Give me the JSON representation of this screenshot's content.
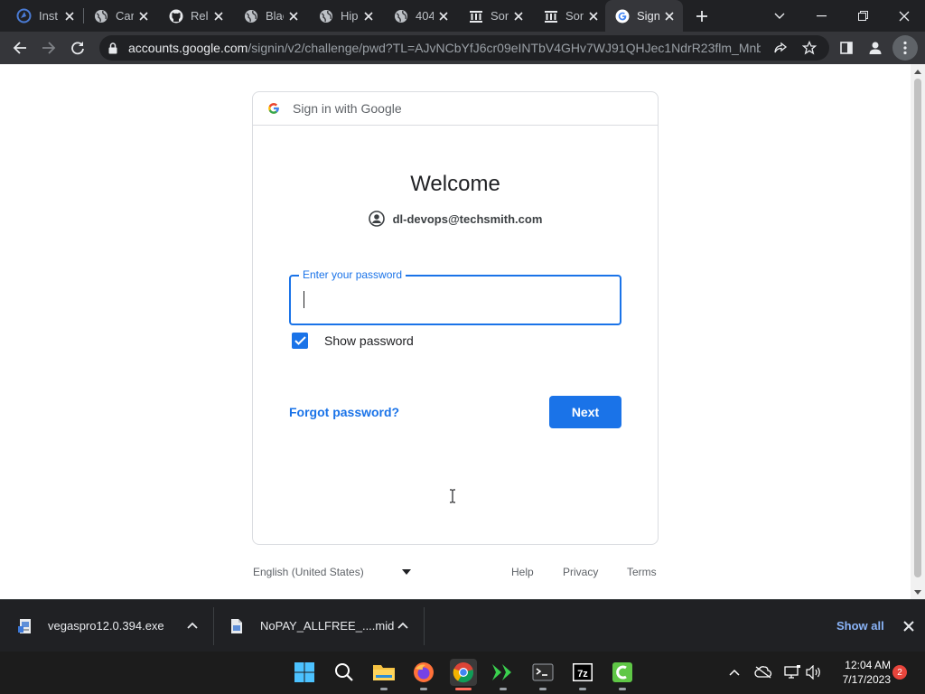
{
  "browser": {
    "tabs": [
      {
        "label": "Inst",
        "icon": "scirate-icon"
      },
      {
        "label": "Car",
        "icon": "globe-icon"
      },
      {
        "label": "Rele",
        "icon": "github-icon"
      },
      {
        "label": "Blac",
        "icon": "globe-icon"
      },
      {
        "label": "Hip",
        "icon": "globe-icon"
      },
      {
        "label": "404",
        "icon": "globe-icon"
      },
      {
        "label": "Son",
        "icon": "institution-icon"
      },
      {
        "label": "Son",
        "icon": "institution-icon"
      },
      {
        "label": "Sign",
        "icon": "google-icon",
        "active": true
      }
    ],
    "url_host": "accounts.google.com",
    "url_path": "/signin/v2/challenge/pwd?TL=AJvNCbYfJ6cr09eINTbV4GHv7WJ91QHJec1NdrR23flm_Mnb..."
  },
  "signin": {
    "header": "Sign in with Google",
    "title": "Welcome",
    "email": "dl-devops@techsmith.com",
    "password_label": "Enter your password",
    "password_value": "",
    "show_password_label": "Show password",
    "show_password_checked": true,
    "forgot_label": "Forgot password?",
    "next_label": "Next",
    "accent_color": "#1a73e8"
  },
  "footer": {
    "language": "English (United States)",
    "help": "Help",
    "privacy": "Privacy",
    "terms": "Terms"
  },
  "downloads": {
    "items": [
      {
        "filename": "vegaspro12.0.394.exe",
        "icon": "installer-file-icon"
      },
      {
        "filename": "NoPAY_ALLFREE_....mid",
        "icon": "midi-file-icon"
      }
    ],
    "show_all_label": "Show all"
  },
  "taskbar": {
    "apps": [
      "start",
      "search",
      "file-explorer",
      "firefox",
      "chrome",
      "app-green-arrows",
      "terminal",
      "7zip",
      "camtasia"
    ],
    "time": "12:04 AM",
    "date": "7/17/2023",
    "notification_count": "2"
  }
}
